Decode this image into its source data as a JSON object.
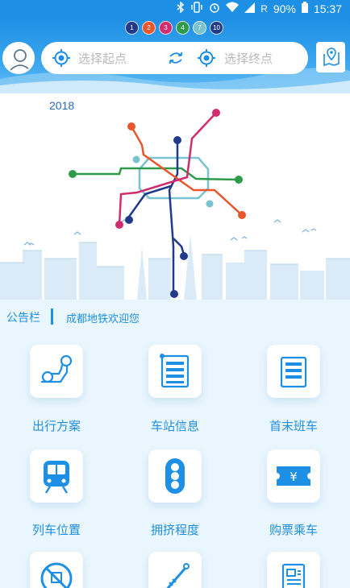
{
  "status_bar": {
    "battery": "90%",
    "network": "R",
    "time": "15:37"
  },
  "metro_lines": [
    {
      "label": "1",
      "color": "#233a8b"
    },
    {
      "label": "2",
      "color": "#e8572b"
    },
    {
      "label": "3",
      "color": "#d12d6e"
    },
    {
      "label": "4",
      "color": "#2f9a4a"
    },
    {
      "label": "7",
      "color": "#7ac2cf"
    },
    {
      "label": "10",
      "color": "#203a88"
    }
  ],
  "search": {
    "start_placeholder": "选择起点",
    "end_placeholder": "选择终点"
  },
  "hero": {
    "year": "2018"
  },
  "notice": {
    "label": "公告栏",
    "message": "成都地铁欢迎您"
  },
  "menu": [
    {
      "label": "出行方案",
      "icon": "route-icon"
    },
    {
      "label": "车站信息",
      "icon": "station-list-icon"
    },
    {
      "label": "首末班车",
      "icon": "schedule-list-icon"
    },
    {
      "label": "列车位置",
      "icon": "train-icon"
    },
    {
      "label": "拥挤程度",
      "icon": "traffic-light-icon"
    },
    {
      "label": "购票乘车",
      "icon": "ticket-icon"
    }
  ],
  "colors": {
    "primary": "#1d8fe4",
    "label": "#1f8ee0",
    "background": "#eaf6fd"
  }
}
